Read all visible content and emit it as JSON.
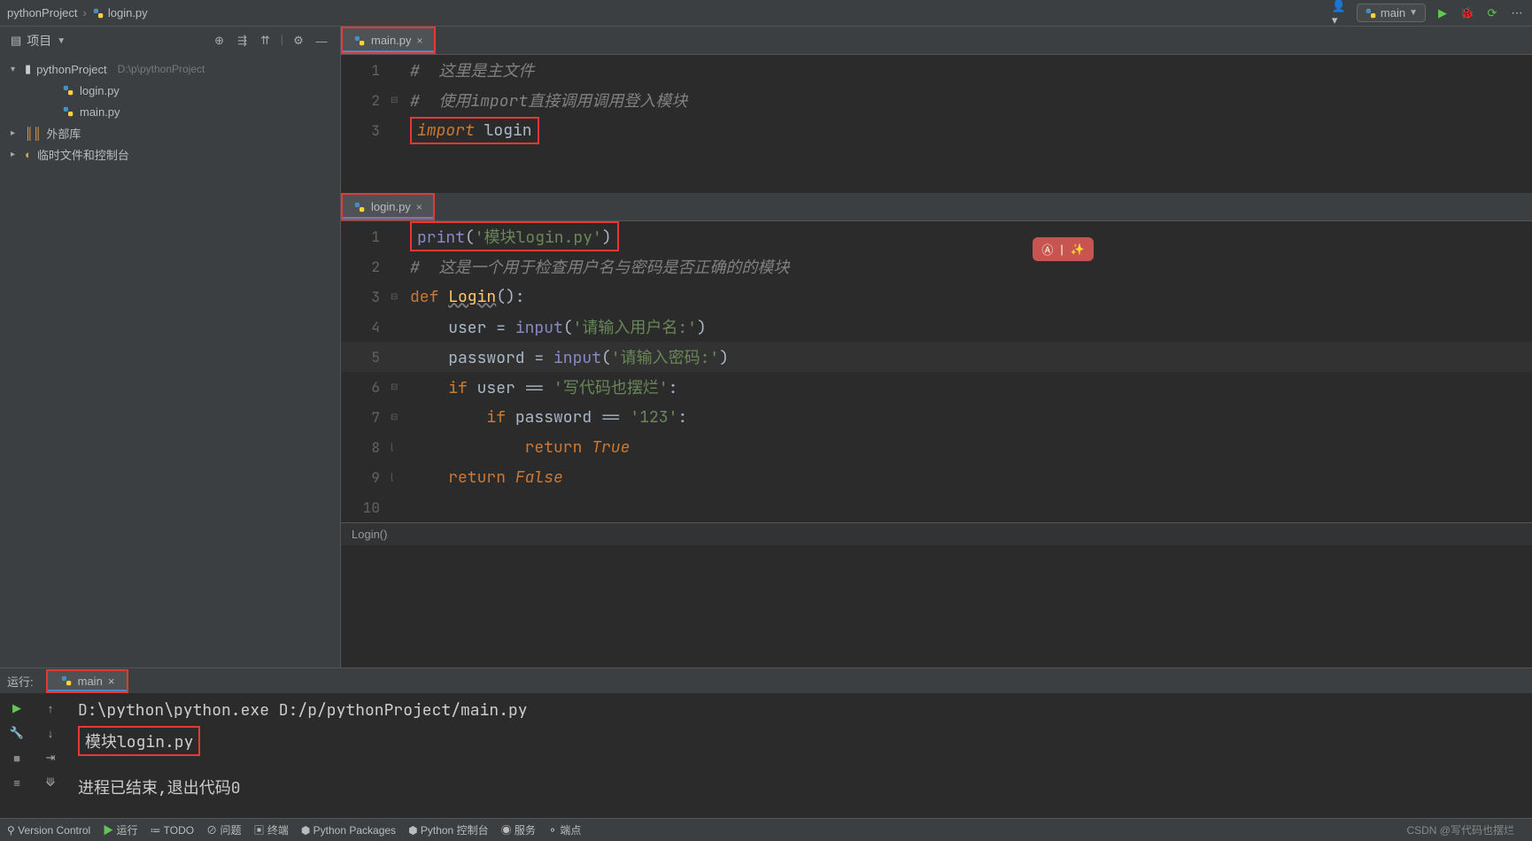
{
  "breadcrumb": {
    "root": "pythonProject",
    "file": "login.py"
  },
  "runConfig": {
    "name": "main"
  },
  "sidebar": {
    "title": "项目",
    "project": {
      "name": "pythonProject",
      "path": "D:\\p\\pythonProject"
    },
    "files": [
      "login.py",
      "main.py"
    ],
    "external": "外部库",
    "scratch": "临时文件和控制台"
  },
  "editor1": {
    "tab": "main.py",
    "lines": {
      "c1": "#  这里是主文件",
      "c2": "#  使用import直接调用调用登入模块",
      "kw": "import",
      "mod": " login"
    }
  },
  "editor2": {
    "tab": "login.py",
    "status": "Login()",
    "l1": {
      "fn": "print",
      "p1": "(",
      "s": "'模块login.py'",
      "p2": ")"
    },
    "l2": "#  这是一个用于检查用户名与密码是否正确的的模块",
    "l3": {
      "def": "def ",
      "name": "Login",
      "rest": "():"
    },
    "l4": {
      "a": "    user = ",
      "fn": "input",
      "p1": "(",
      "s": "'请输入用户名:'",
      "p2": ")"
    },
    "l5": {
      "a": "    password = ",
      "fn": "input",
      "p1": "(",
      "s": "'请输入密码:'",
      "p2": ")"
    },
    "l6": {
      "kw": "    if ",
      "a": "user == ",
      "s": "'写代码也摆烂'",
      "c": ":"
    },
    "l7": {
      "kw": "        if ",
      "a": "password == ",
      "s": "'123'",
      "c": ":"
    },
    "l8": {
      "kw": "            return ",
      "v": "True"
    },
    "l9": {
      "kw": "    return ",
      "v": "False"
    }
  },
  "run": {
    "label": "运行:",
    "tab": "main",
    "out1": "D:\\python\\python.exe D:/p/pythonProject/main.py",
    "out2": "模块login.py",
    "out3": "进程已结束,退出代码0"
  },
  "bottom": {
    "vcs": "Version Control",
    "run": "运行",
    "todo": "TODO",
    "problems": "问题",
    "terminal": "终端",
    "pkgs": "Python Packages",
    "pyconsole": "Python 控制台",
    "services": "服务",
    "endpoints": "端点"
  },
  "watermark": "CSDN @写代码也摆烂"
}
